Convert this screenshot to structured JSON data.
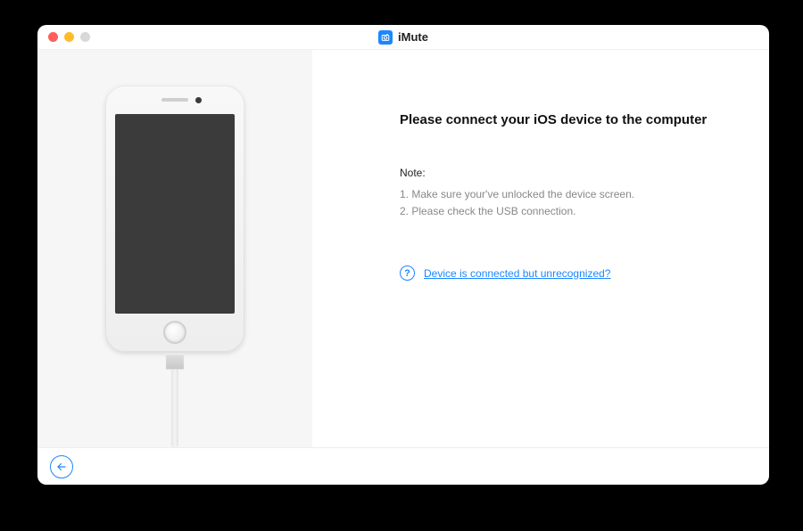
{
  "app": {
    "title": "iMute"
  },
  "main": {
    "heading": "Please connect your iOS device to the computer",
    "note_label": "Note:",
    "notes": [
      "1. Make sure your've unlocked the device screen.",
      "2. Please check the USB connection."
    ],
    "help_link": "Device is connected but unrecognized?"
  }
}
